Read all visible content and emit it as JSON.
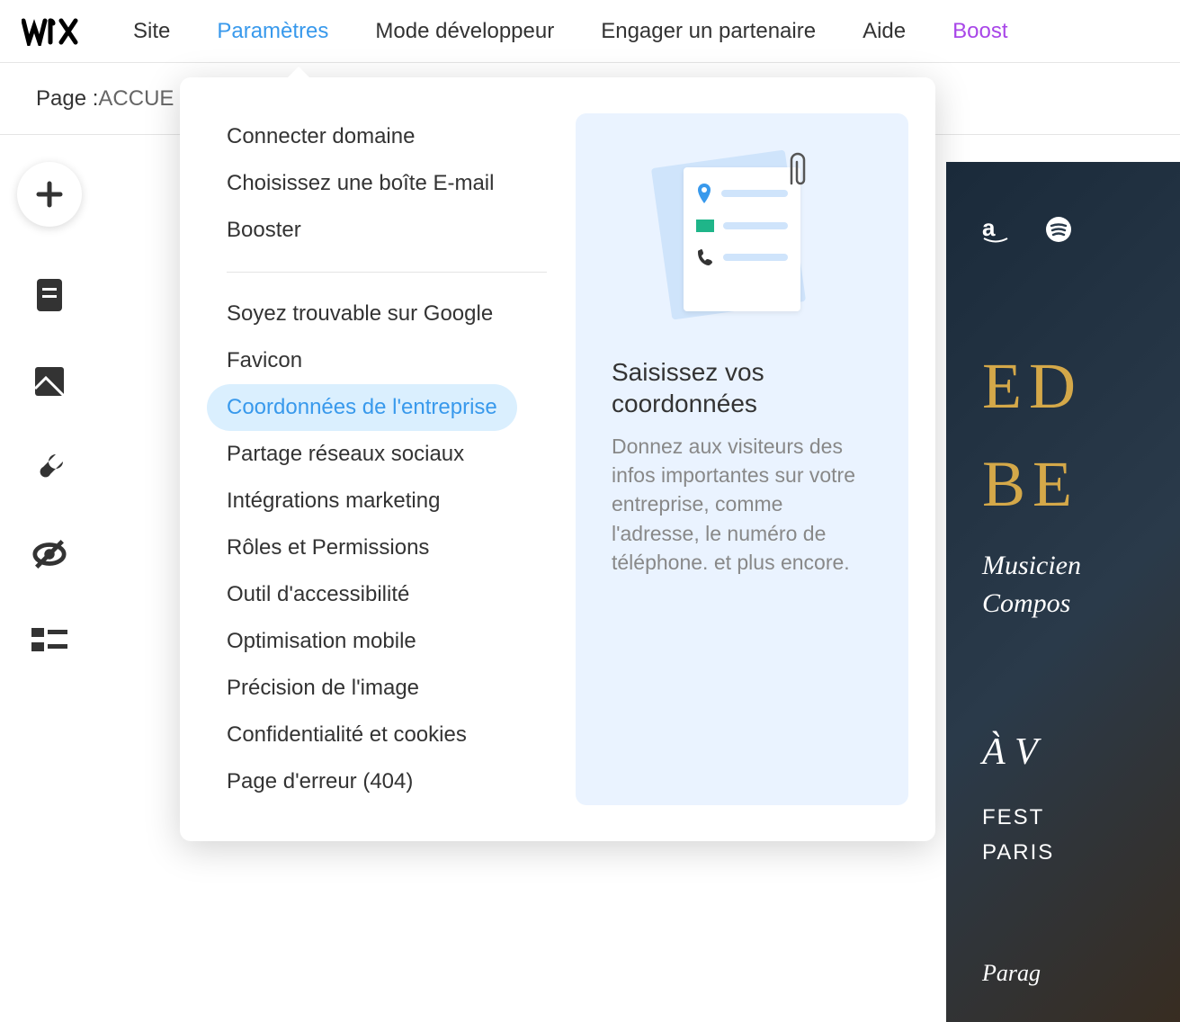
{
  "topnav": {
    "items": [
      "Site",
      "Paramètres",
      "Mode développeur",
      "Engager un partenaire",
      "Aide",
      "Boost"
    ],
    "activeIndex": 1,
    "accentIndex": 5
  },
  "subbar": {
    "label": "Page : ",
    "value": "ACCUE"
  },
  "settingsMenu": {
    "group1": [
      "Connecter domaine",
      "Choisissez une boîte E-mail",
      "Booster"
    ],
    "group2": [
      "Soyez trouvable sur Google",
      "Favicon",
      "Coordonnées de l'entreprise",
      "Partage réseaux sociaux",
      "Intégrations marketing",
      "Rôles et Permissions",
      "Outil d'accessibilité",
      "Optimisation mobile",
      "Précision de l'image",
      "Confidentialité et cookies",
      "Page d'erreur (404)"
    ],
    "selectedIndex": 2
  },
  "preview": {
    "title": "Saisissez vos coordonnées",
    "description": "Donnez aux visiteurs des infos importantes sur votre entreprise, comme l'adresse, le numéro de téléphone. et plus encore."
  },
  "canvas": {
    "titleLine1": "ED",
    "titleLine2": "BE",
    "subtitle1": "Musicien",
    "subtitle2": "Compos",
    "section": "À V",
    "body1": "FEST",
    "body2": "PARIS",
    "footnote": "Parag"
  }
}
